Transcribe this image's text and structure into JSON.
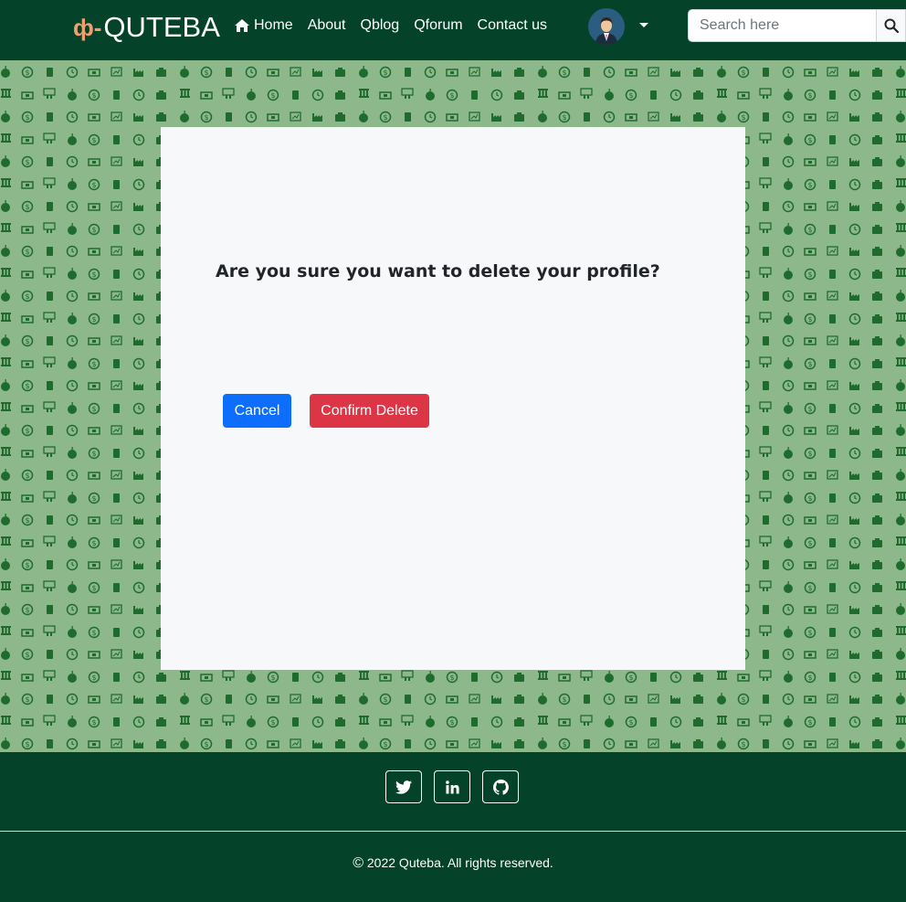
{
  "brand": {
    "logo_glyph": "ф-",
    "name": "QUTEBA"
  },
  "nav": {
    "items": [
      {
        "label": "Home",
        "icon": "home-icon"
      },
      {
        "label": "About"
      },
      {
        "label": "Qblog"
      },
      {
        "label": "Qforum"
      },
      {
        "label": "Contact us"
      }
    ]
  },
  "search": {
    "placeholder": "Search here",
    "button_icon": "search-icon"
  },
  "modal": {
    "question": "Are you sure you want to delete your profile?",
    "cancel_label": "Cancel",
    "confirm_label": "Confirm Delete"
  },
  "footer": {
    "social": [
      "twitter-icon",
      "linkedin-icon",
      "github-icon"
    ],
    "copyright_symbol": "©",
    "copyright": "2022 Quteba. All rights reserved."
  },
  "colors": {
    "nav_bg": "#04422a",
    "pattern_bg": "#8cb88c",
    "pattern_icons": "#1f6b2e",
    "card_bg": "#f7f8fa",
    "primary": "#0d6efd",
    "danger": "#dc3545",
    "logo_accent": "#f0a070"
  }
}
